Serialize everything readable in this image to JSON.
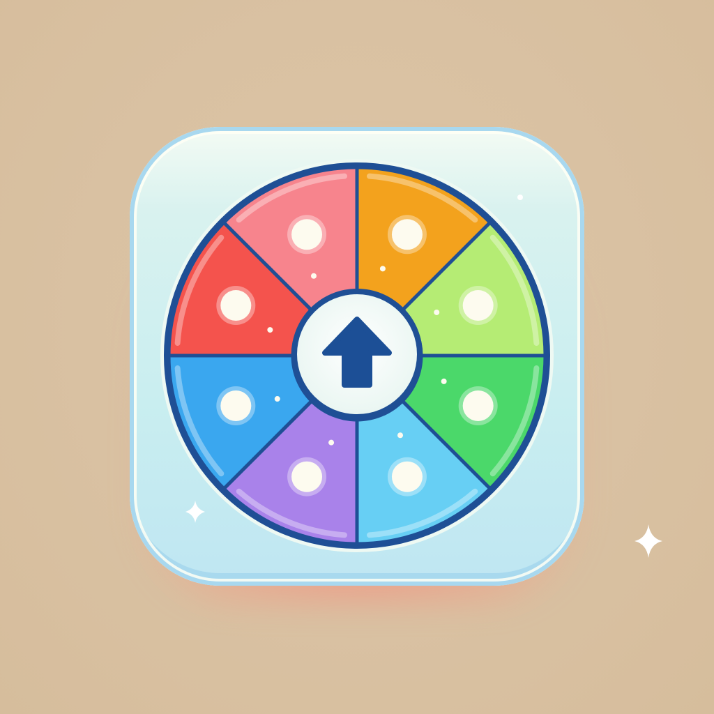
{
  "icon": {
    "name": "spin-wheel-app-icon",
    "center_icon": "arrow-up-icon"
  },
  "colors": {
    "background": "#dbc3a4",
    "tile": "#c9eef0",
    "wheel_outline": "#1f4f95",
    "arrow": "#1c4f96",
    "segments": [
      "#f3a21d",
      "#b5ec74",
      "#4bd86a",
      "#67cff4",
      "#a982ea",
      "#3aa7ef",
      "#f4534d",
      "#f7848d"
    ]
  },
  "wheel": {
    "segment_count": 8
  }
}
